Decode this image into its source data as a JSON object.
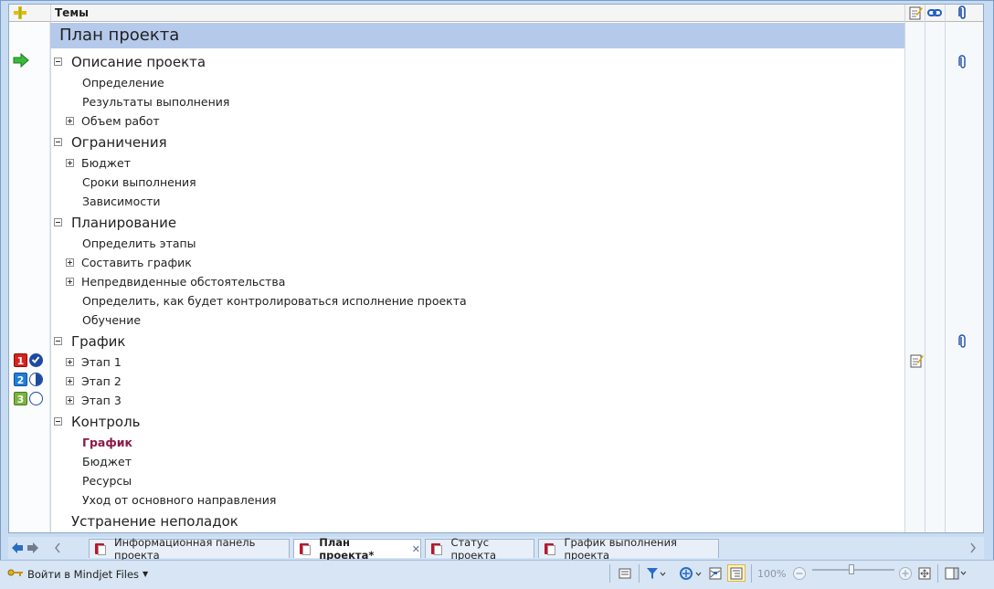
{
  "header": {
    "topics_label": "Темы"
  },
  "map_title": "План проекта",
  "topics": [
    {
      "label": "Описание проекта",
      "children": [
        {
          "label": "Определение"
        },
        {
          "label": "Результаты выполнения"
        },
        {
          "label": "Объем работ"
        }
      ]
    },
    {
      "label": "Ограничения",
      "children": [
        {
          "label": "Бюджет"
        },
        {
          "label": "Сроки выполнения"
        },
        {
          "label": "Зависимости"
        }
      ]
    },
    {
      "label": "Планирование",
      "children": [
        {
          "label": "Определить этапы"
        },
        {
          "label": "Составить график"
        },
        {
          "label": "Непредвиденные обстоятельства"
        },
        {
          "label": "Определить, как будет контролироваться исполнение проекта"
        },
        {
          "label": "Обучение"
        }
      ]
    },
    {
      "label": "График",
      "children": [
        {
          "label": "Этап 1",
          "priority": "1"
        },
        {
          "label": "Этап 2",
          "priority": "2"
        },
        {
          "label": "Этап 3",
          "priority": "3"
        }
      ]
    },
    {
      "label": "Контроль",
      "children": [
        {
          "label": "График"
        },
        {
          "label": "Бюджет"
        },
        {
          "label": "Ресурсы"
        },
        {
          "label": "Уход от основного направления"
        }
      ]
    },
    {
      "label": "Устранение неполадок"
    }
  ],
  "progress": {
    "stage1": 1.0,
    "stage2": 0.5,
    "stage3": 0.0
  },
  "tabs": [
    {
      "label": "Информационная панель проекта"
    },
    {
      "label": "План проекта*"
    },
    {
      "label": "Статус проекта"
    },
    {
      "label": "График выполнения проекта"
    }
  ],
  "status": {
    "login_label": "Войти в Mindjet Files",
    "zoom": "100%"
  },
  "colors": {
    "title_row": "#b5c9eb",
    "selected_topic": "#8b1a4a",
    "priority1": "#d9221c",
    "priority2": "#1e7fd8",
    "priority3": "#7cb342"
  },
  "icons": {
    "header": [
      "add-topic-icon",
      "notes-icon",
      "link-icon",
      "attachment-icon"
    ],
    "row": [
      "next-arrow-icon",
      "attachment-icon",
      "notes-icon"
    ]
  }
}
